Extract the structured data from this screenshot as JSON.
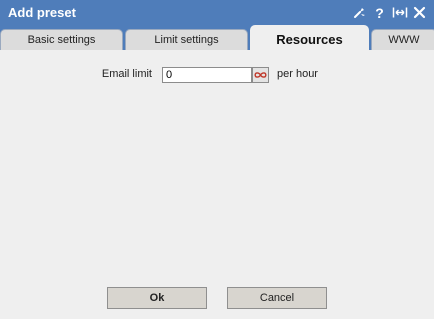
{
  "window": {
    "title": "Add preset",
    "icons": [
      "wrench-icon",
      "help-icon",
      "resize-icon",
      "close-icon"
    ],
    "help_glyph": "?",
    "title_bar_color": "#4f7dba"
  },
  "tabs": [
    {
      "label": "Basic settings",
      "active": false
    },
    {
      "label": "Limit settings",
      "active": false
    },
    {
      "label": "Resources",
      "active": true
    },
    {
      "label": "WWW",
      "active": false
    }
  ],
  "form": {
    "email_limit": {
      "label": "Email limit",
      "value": "0",
      "unit": "per hour",
      "infinity_icon": "infinity-icon",
      "infinity_color": "#c0392b"
    }
  },
  "buttons": {
    "ok_label": "Ok",
    "cancel_label": "Cancel"
  }
}
